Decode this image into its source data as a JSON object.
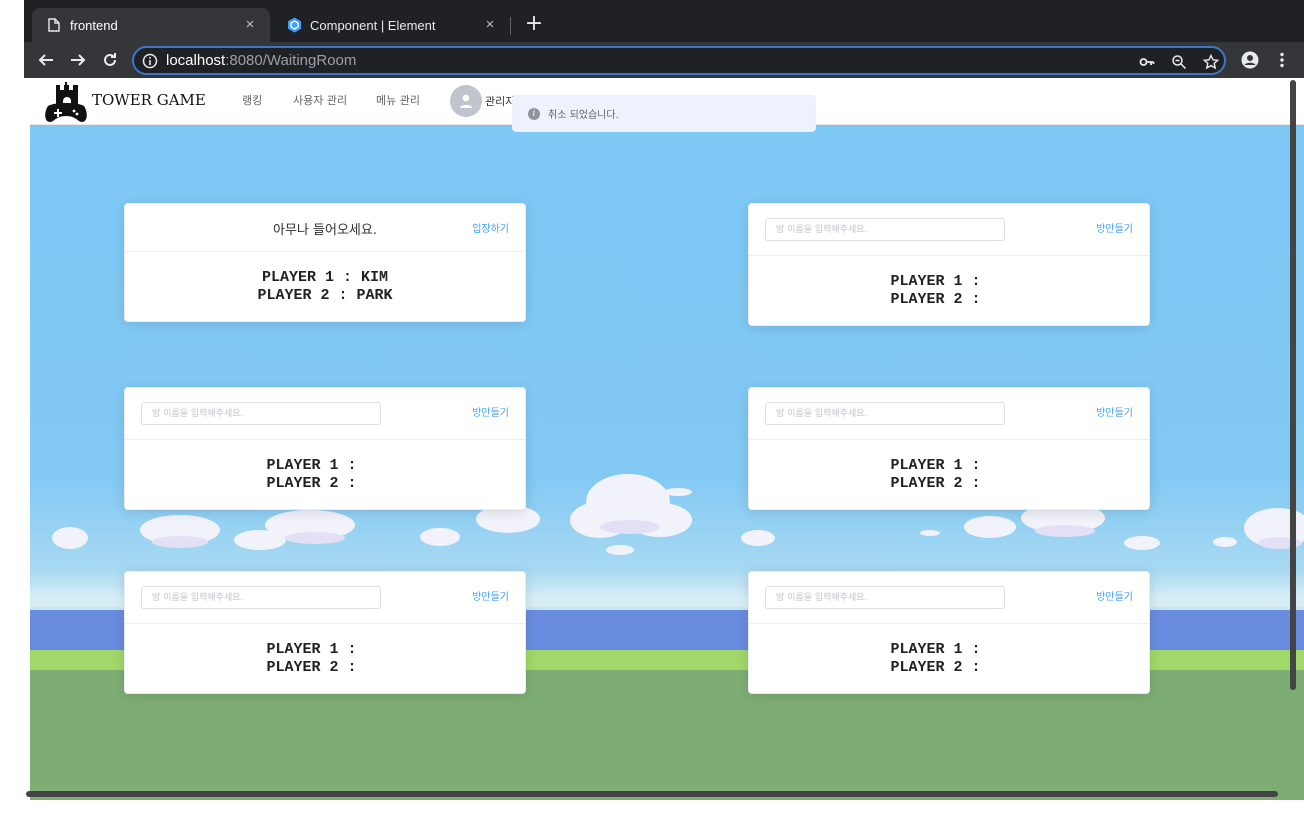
{
  "browser": {
    "tabs": [
      {
        "title": "frontend",
        "icon": "document-icon",
        "active": true
      },
      {
        "title": "Component | Element",
        "icon": "element-hexagon-icon",
        "active": false
      }
    ],
    "new_tab": "+",
    "close_glyph": "×",
    "url": {
      "host": "localhost",
      "rest": ":8080/WaitingRoom"
    }
  },
  "app": {
    "logo_text": "TOWER GAME",
    "menu": [
      "랭킹",
      "사용자 관리",
      "메뉴 관리"
    ],
    "user_label": "관리자"
  },
  "toast": {
    "message": "취소 되었습니다.",
    "type": "info"
  },
  "rooms": [
    {
      "title": "아무나 들어오세요.",
      "button": "입장하기",
      "players": "PLAYER 1 : KIM\nPLAYER 2 : PARK"
    },
    {
      "input_placeholder": "방 이름을 입력해주세요.",
      "button": "방만들기",
      "players": "PLAYER 1 :   \nPLAYER 2 :   "
    },
    {
      "input_placeholder": "방 이름을 입력해주세요.",
      "button": "방만들기",
      "players": "PLAYER 1 :   \nPLAYER 2 :   "
    },
    {
      "input_placeholder": "방 이름을 입력해주세요.",
      "button": "방만들기",
      "players": "PLAYER 1 :   \nPLAYER 2 :   "
    },
    {
      "input_placeholder": "방 이름을 입력해주세요.",
      "button": "방만들기",
      "players": "PLAYER 1 :   \nPLAYER 2 :   "
    },
    {
      "input_placeholder": "방 이름을 입력해주세요.",
      "button": "방만들기",
      "players": "PLAYER 1 :   \nPLAYER 2 :   "
    }
  ],
  "colors": {
    "accent": "#409eff",
    "sky": "#7ec8f5",
    "grass": "#7ead73",
    "chrome_dark": "#202124"
  }
}
